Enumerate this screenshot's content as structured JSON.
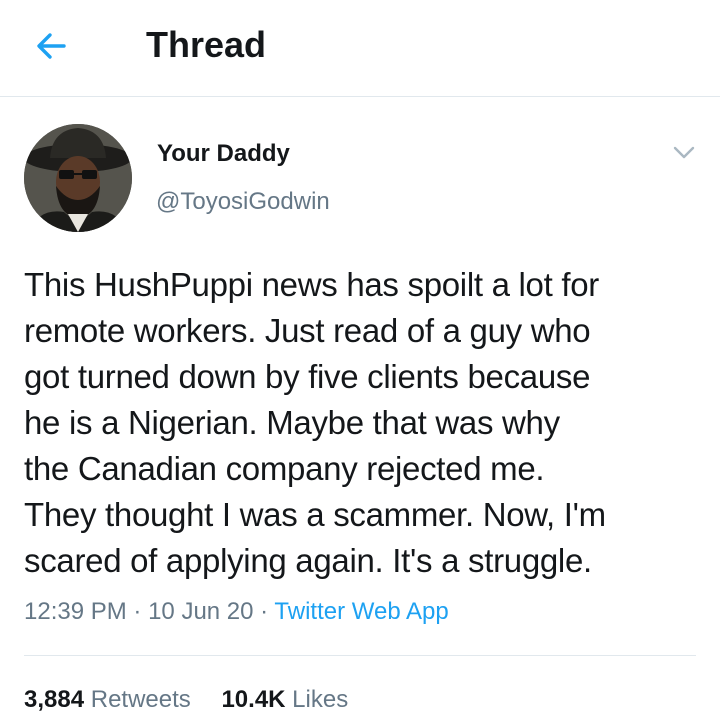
{
  "header": {
    "title": "Thread",
    "back_icon": "arrow-left-icon",
    "accent_color": "#1da1f2"
  },
  "tweet": {
    "author": {
      "display_name": "Your Daddy",
      "handle": "@ToyosiGodwin"
    },
    "menu_icon": "chevron-down-icon",
    "text": "This HushPuppi news has spoilt a lot for\nremote workers. Just read of a guy who\ngot turned down by five clients because\nhe is a Nigerian. Maybe that was why\nthe Canadian company rejected me.\nThey thought I was a scammer. Now, I'm\nscared of applying again.  It's a struggle.",
    "time": "12:39 PM",
    "date": "10 Jun 20",
    "separator": "·",
    "source": "Twitter Web App",
    "stats": {
      "retweets_count": "3,884",
      "retweets_label": "Retweets",
      "likes_count": "10.4K",
      "likes_label": "Likes"
    }
  },
  "colors": {
    "text": "#14171a",
    "secondary": "#657786",
    "link": "#1da1f2",
    "border": "#e1e8ed"
  }
}
